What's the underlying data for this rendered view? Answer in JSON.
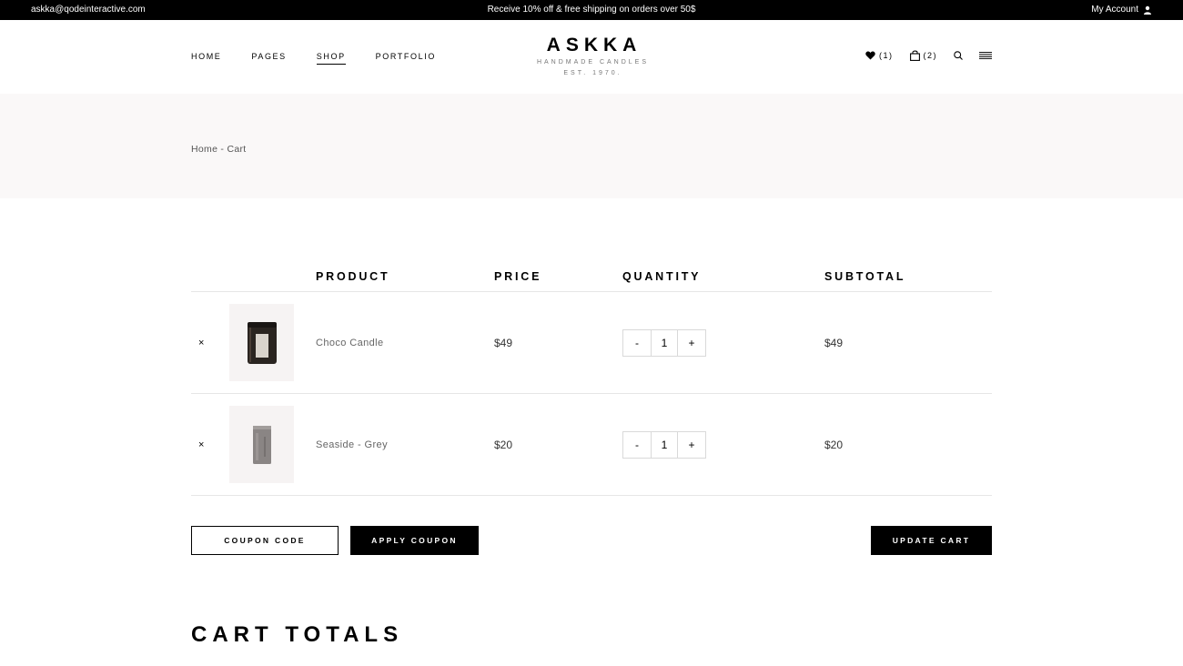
{
  "topbar": {
    "email": "askka@qodeinteractive.com",
    "promo": "Receive 10% off & free shipping on orders over 50$",
    "account": "My Account"
  },
  "nav": {
    "items": [
      "HOME",
      "PAGES",
      "SHOP",
      "PORTFOLIO"
    ],
    "active": "SHOP"
  },
  "logo": {
    "name": "ASKKA",
    "tagline": "HANDMADE CANDLES",
    "est": "EST. 1970."
  },
  "header_icons": {
    "wishlist_count": "(1)",
    "cart_count": "(2)",
    "icons": [
      "heart-icon",
      "bag-icon",
      "search-icon",
      "menu-icon"
    ]
  },
  "breadcrumb": "Home - Cart",
  "cart": {
    "headers": [
      "PRODUCT",
      "PRICE",
      "QUANTITY",
      "SUBTOTAL"
    ],
    "rows": [
      {
        "remove": "×",
        "name": "Choco Candle",
        "price": "$49",
        "quantity": "1",
        "subtotal": "$49",
        "minus": "-",
        "plus": "+"
      },
      {
        "remove": "×",
        "name": "Seaside - Grey",
        "price": "$20",
        "quantity": "1",
        "subtotal": "$20",
        "minus": "-",
        "plus": "+"
      }
    ]
  },
  "actions": {
    "coupon_placeholder": "COUPON CODE",
    "apply": "APPLY COUPON",
    "update": "UPDATE CART"
  },
  "totals_title": "CART TOTALS",
  "colors": {
    "accent": "#000000",
    "title_bg": "#faf8f8",
    "divider": "#e6e6e6"
  }
}
